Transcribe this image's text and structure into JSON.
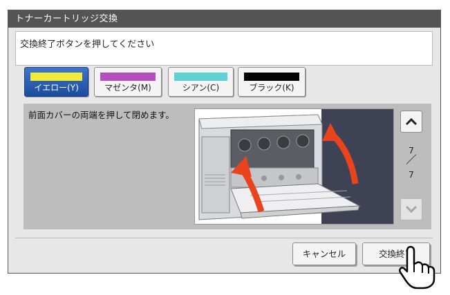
{
  "window": {
    "title": "トナーカートリッジ交換"
  },
  "message": "交換終了ボタンを押してください",
  "color_buttons": [
    {
      "label": "イエロー(Y)",
      "swatch": "#f2ea3b",
      "selected": true
    },
    {
      "label": "マゼンタ(M)",
      "swatch": "#b54fbe",
      "selected": false
    },
    {
      "label": "シアン(C)",
      "swatch": "#5fd2d6",
      "selected": false
    },
    {
      "label": "ブラック(K)",
      "swatch": "#000000",
      "selected": false
    }
  ],
  "instruction": "前面カバーの両端を押して閉めます。",
  "illustration": {
    "icon": "close-front-cover-illustration"
  },
  "pager": {
    "current": "7",
    "total": "7",
    "up_icon": "chevron-up-icon",
    "down_icon": "chevron-down-icon"
  },
  "buttons": {
    "cancel": "キャンセル",
    "finish": "交換終了"
  },
  "cursor": {
    "icon": "hand-pointer-icon"
  },
  "colors": {
    "title_bar": "#545454",
    "selected_tab": "#2a5cb0",
    "arrow": "#e8441e"
  }
}
